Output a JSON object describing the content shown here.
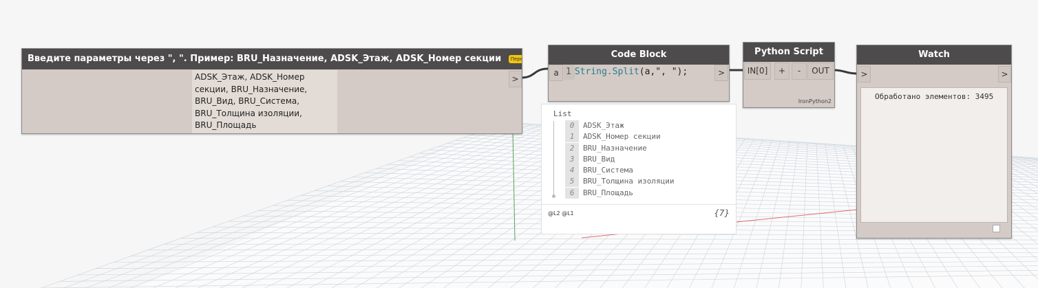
{
  "nodes": {
    "string_input": {
      "title": "Введите параметры через \", \". Пример: BRU_Назначение, ADSK_Этаж, ADSK_Номер секции",
      "badge": "Переименовано",
      "value_lines": [
        "ADSK_Этаж, ADSK_Номер",
        "секции, BRU_Назначение,",
        "BRU_Вид, BRU_Система,",
        "BRU_Толщина изоляции,",
        "BRU_Площадь"
      ],
      "output_port": ">"
    },
    "code_block": {
      "title": "Code Block",
      "input_port": "a",
      "line_number": "1",
      "code_fn": "String",
      "code_method": ".Split",
      "code_rest": "(a,\", \");",
      "output_port": ">"
    },
    "python_script": {
      "title": "Python Script",
      "input_port": "IN[0]",
      "add_label": "+",
      "remove_label": "-",
      "output_port": "OUT",
      "engine": "IronPython2"
    },
    "watch": {
      "title": "Watch",
      "input_port": ">",
      "output_port": ">",
      "text": "Обработано элементов: 3495"
    }
  },
  "preview": {
    "header": "List",
    "items": [
      {
        "index": "0",
        "value": "ADSK_Этаж"
      },
      {
        "index": "1",
        "value": "ADSK_Номер секции"
      },
      {
        "index": "2",
        "value": "BRU_Назначение"
      },
      {
        "index": "3",
        "value": "BRU_Вид"
      },
      {
        "index": "4",
        "value": "BRU_Система"
      },
      {
        "index": "5",
        "value": "BRU_Толщина изоляции"
      },
      {
        "index": "6",
        "value": "BRU_Площадь"
      }
    ],
    "levels": "@L2 @L1",
    "count": "{7}"
  },
  "colors": {
    "header": "#4d4b4b",
    "node_body": "#d4cbc6",
    "badge": "#f1c40f",
    "code_fn": "#2a7d8e",
    "grid": "#c9d3dd",
    "axis_red": "#e36a6a",
    "axis_green": "#5aa05a"
  }
}
